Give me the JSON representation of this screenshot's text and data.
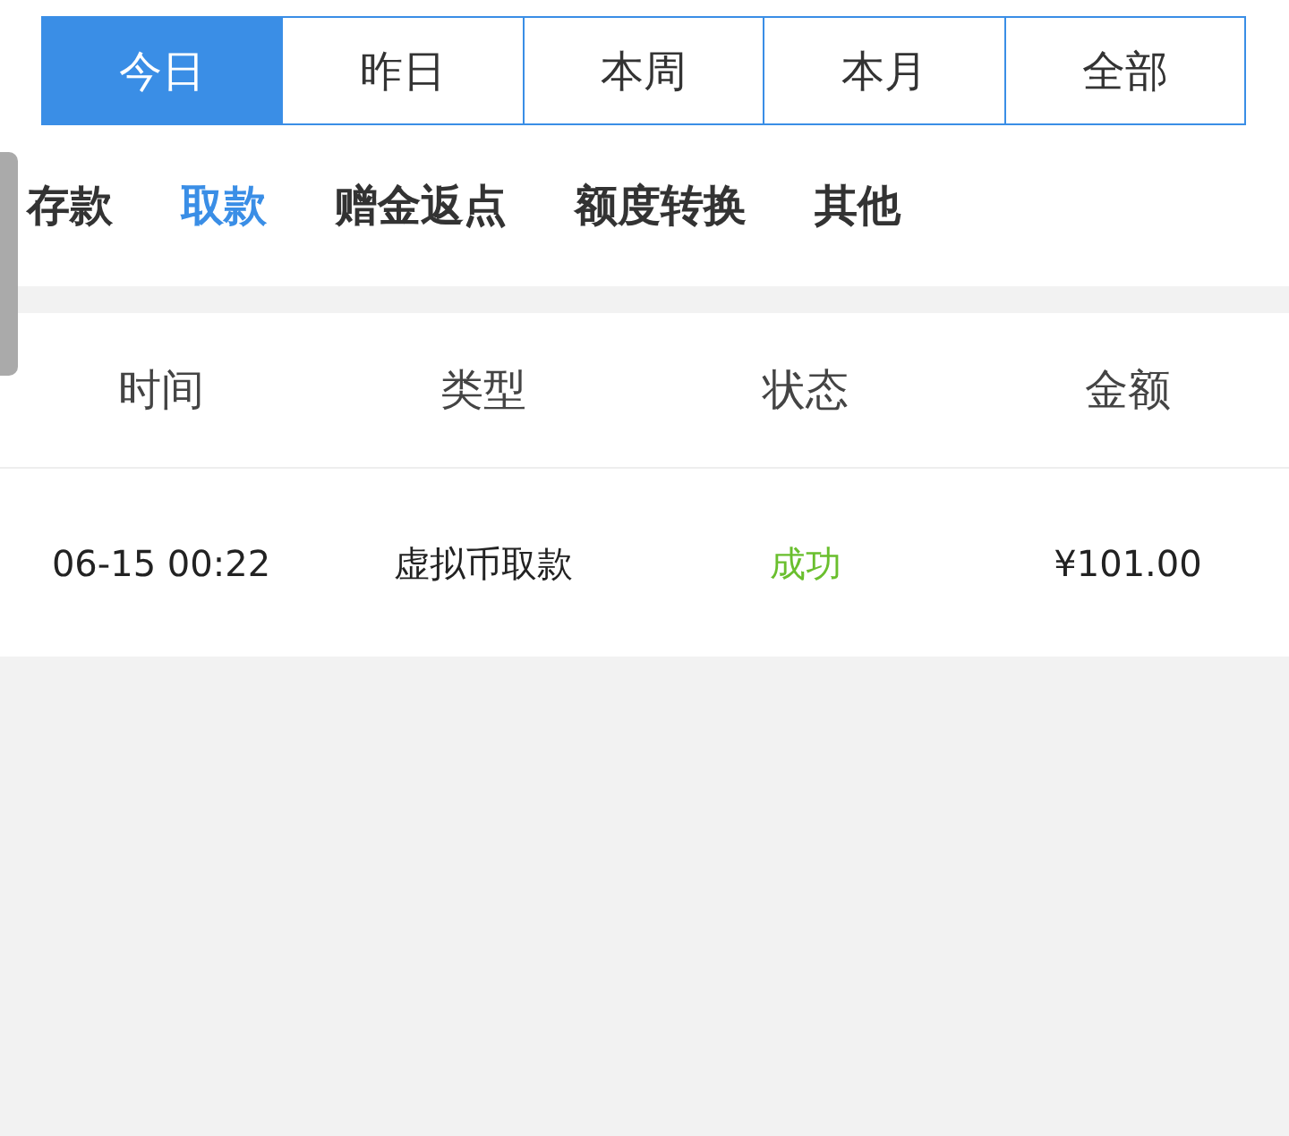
{
  "date_tabs": [
    {
      "label": "今日",
      "selected": true
    },
    {
      "label": "昨日",
      "selected": false
    },
    {
      "label": "本周",
      "selected": false
    },
    {
      "label": "本月",
      "selected": false
    },
    {
      "label": "全部",
      "selected": false
    }
  ],
  "category_tabs": [
    {
      "label": "存款",
      "selected": false
    },
    {
      "label": "取款",
      "selected": true
    },
    {
      "label": "赠金返点",
      "selected": false
    },
    {
      "label": "额度转换",
      "selected": false
    },
    {
      "label": "其他",
      "selected": false
    }
  ],
  "table": {
    "columns": [
      "时间",
      "类型",
      "状态",
      "金额"
    ],
    "rows": [
      {
        "time": "06-15 00:22",
        "type": "虚拟币取款",
        "status": "成功",
        "kind": "success",
        "amount": "¥101.00"
      }
    ]
  }
}
